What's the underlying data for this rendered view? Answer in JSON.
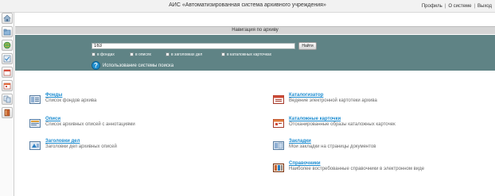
{
  "header": {
    "title": "АИС «Автоматизированная система архивного учреждения»",
    "links": [
      "Профиль",
      "О системе",
      "Выход"
    ]
  },
  "toolbar": {
    "icons": [
      "home-icon",
      "folders-icon",
      "globe-icon",
      "document-check-icon",
      "calendar-icon",
      "calendar-alt-icon",
      "copy-icon",
      "book-icon"
    ]
  },
  "nav": {
    "header": "Навигация по архиву"
  },
  "search": {
    "value": "163",
    "button_label": "Найти",
    "scopes": [
      "в фондах",
      "в описях",
      "в заголовках дел",
      "в каталожных карточках"
    ],
    "help_link": "Использование системы поиска"
  },
  "sections": {
    "left": [
      {
        "title": "Фонды",
        "desc": "Список фондов архива"
      },
      {
        "title": "Описи",
        "desc": "Список архивных описей с аннотациями"
      },
      {
        "title": "Заголовки дел",
        "desc": "Заголовки дел архивных описей"
      }
    ],
    "right": [
      {
        "title": "Каталогизатор",
        "desc": "Ведение электронной картотеки архива"
      },
      {
        "title": "Каталожные карточки",
        "desc": "Отсканированные образы каталожных карточек"
      },
      {
        "title": "Закладки",
        "desc": "Мои закладки на страницы документов"
      },
      {
        "title": "Справочники",
        "desc": "Наиболее востребованные справочники в электронном виде"
      }
    ]
  },
  "colors": {
    "search_panel": "#5f8385",
    "link": "#1a8bd0",
    "help_icon": "#1e8fd0"
  }
}
